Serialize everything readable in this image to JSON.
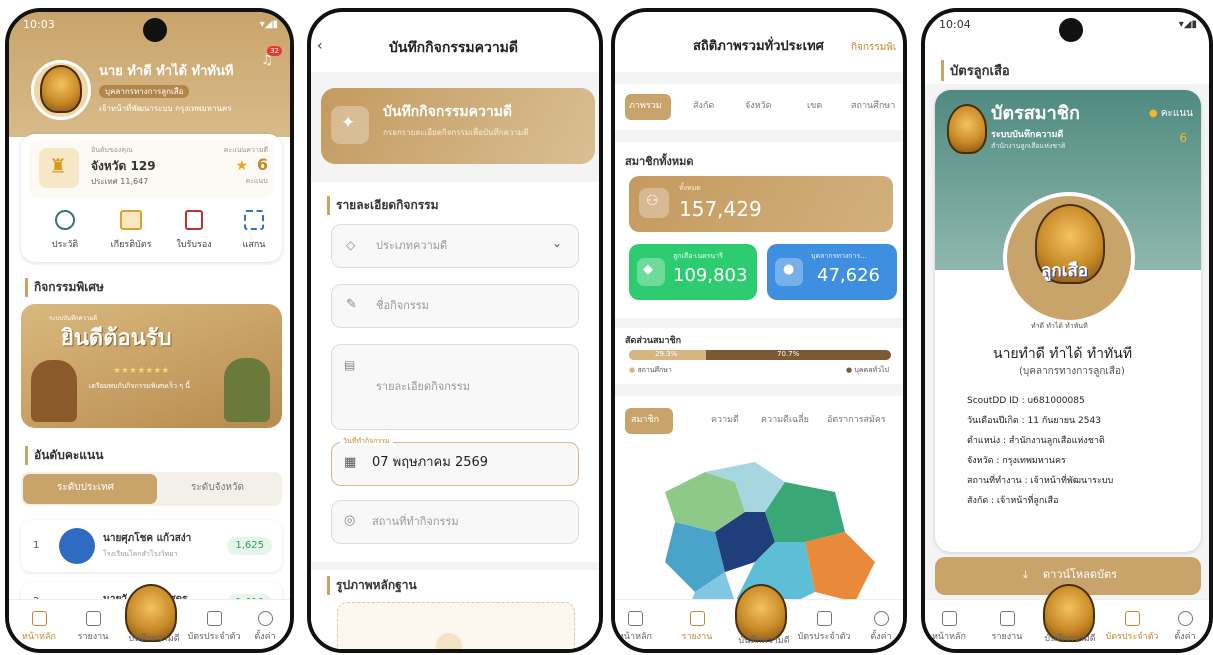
{
  "s1": {
    "time": "10:03",
    "notif_count": "32",
    "user_name": "นาย ทำดี ทำได้ ทำทันที",
    "role_badge": "บุคลากรทางการลูกเสือ",
    "location": "เจ้าหน้าที่พัฒนาระบบ กรุงเทพมหานคร",
    "rank_caption": "อันดับของคุณ",
    "province_rank": "จังหวัด 129",
    "country_rank": "ประเทศ 11,647",
    "score_caption": "คะแนนความดี",
    "score": "6",
    "score_unit": "คะแนน",
    "quick": [
      "ประวัติ",
      "เกียรติบัตร",
      "ใบรับรอง",
      "แสกน"
    ],
    "special_title": "กิจกรรมพิเศษ",
    "banner_small": "ระบบบันทึกความดี",
    "banner_title": "ยินดีต้อนรับ",
    "banner_sub": "เตรียมพบกับกิจกรรมพิเศษเร็ว ๆ นี้",
    "ranking_title": "อันดับคะแนน",
    "tab_country": "ระดับประเทศ",
    "tab_province": "ระดับจังหวัด",
    "rows": [
      {
        "rank": "1",
        "name": "นายศุภโชค แก้วสง่า",
        "school": "โรงเรียนโคกสำโรงวิทยา",
        "score": "1,625"
      },
      {
        "rank": "2",
        "name": "นายวั...ร์พันธ์อัศดร",
        "school": "",
        "score": "1,610"
      }
    ],
    "nav": [
      "หน้าหลัก",
      "รายงาน",
      "บันทึกความดี",
      "บัตรประจำตัว",
      "ตั้งค่า"
    ]
  },
  "s2": {
    "title": "บันทึกกิจกรรมความดี",
    "hero_title": "บันทึกกิจกรรมความดี",
    "hero_sub": "กรอกรายละเอียดกิจกรรมเพื่อบันทึกความดี",
    "section_detail": "รายละเอียดกิจกรรม",
    "type_ph": "ประเภทความดี",
    "name_ph": "ชื่อกิจกรรม",
    "detail_ph": "รายละเอียดกิจกรรม",
    "date_label": "วันที่ทำกิจกรรม",
    "date_value": "07 พฤษภาคม 2569",
    "place_ph": "สถานที่ทำกิจกรรม",
    "section_photo": "รูปภาพหลักฐาน"
  },
  "s3": {
    "title": "สถิติภาพรวมทั่วประเทศ",
    "title_right": "กิจกรรมพิเ",
    "tabs": [
      "ภาพรวม",
      "สังกัด",
      "จังหวัด",
      "เขต",
      "สถานศึกษา"
    ],
    "members_title": "สมาชิกทั้งหมด",
    "total_label": "ทั้งหมด",
    "total_value": "157,429",
    "scout_label": "ลูกเสือ-เนตรนารี",
    "scout_value": "109,803",
    "staff_label": "บุคลากรทางการ...",
    "staff_value": "47,626",
    "ratio_title": "สัดส่วนสมาชิก",
    "ratio_a": "29.3%",
    "ratio_b": "70.7%",
    "ratio_a_pct": 29.3,
    "legend_a": "สถานศึกษา",
    "legend_b": "บุคคลทั่วไป",
    "tabs2": [
      "สมาชิก",
      "ความดี",
      "ความดีเฉลี่ย",
      "อัตราการสมัคร"
    ],
    "nav": [
      "หน้าหลัก",
      "รายงาน",
      "บันทึกความดี",
      "บัตรประจำตัว",
      "ตั้งค่า"
    ]
  },
  "s4": {
    "time": "10:04",
    "title": "บัตรลูกเสือ",
    "card_title": "บัตรสมาชิก",
    "card_sub": "ระบบบันทึกความดี",
    "card_org": "สำนักงานลูกเสือแห่งชาติ",
    "score_label": "คะแนน",
    "score": "6",
    "logo_text": "ลูกเสือ",
    "logo_sub": "ทำดี ทำได้ ทำทันที",
    "name": "นายทำดี ทำได้ ทำทันที",
    "role": "(บุคลากรทางการลูกเสือ)",
    "details": [
      "ScoutDD ID : u681000085",
      "วันเดือนปีเกิด : 11 กันยายน 2543",
      "ตำแหน่ง : สำนักงานลูกเสือแห่งชาติ",
      "จังหวัด : กรุงเทพมหานคร",
      "สถานที่ทำงาน : เจ้าหน้าที่พัฒนาระบบ",
      "สังกัด : เจ้าหน้าที่ลูกเสือ"
    ],
    "download": "ดาวน์โหลดบัตร",
    "nav": [
      "หน้าหลัก",
      "รายงาน",
      "บันทึกความดี",
      "บัตรประจำตัว",
      "ตั้งค่า"
    ]
  },
  "colors": {
    "gold": "#c9a46a",
    "green": "#2ecc71",
    "blue": "#3f8fe0",
    "brown": "#7a5a34"
  }
}
